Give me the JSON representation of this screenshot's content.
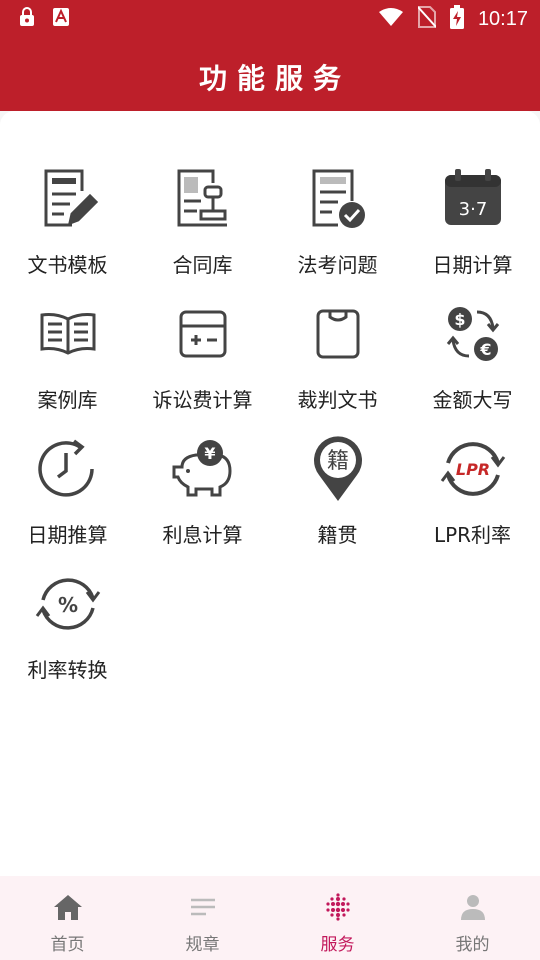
{
  "status_bar": {
    "time": "10:17"
  },
  "page_title": "功能服务",
  "services": [
    {
      "label": "文书模板",
      "icon": "document-edit-icon"
    },
    {
      "label": "合同库",
      "icon": "contract-stamp-icon"
    },
    {
      "label": "法考问题",
      "icon": "document-check-icon"
    },
    {
      "label": "日期计算",
      "icon": "calendar-icon",
      "icon_text": "3·7"
    },
    {
      "label": "案例库",
      "icon": "open-book-icon"
    },
    {
      "label": "诉讼费计算",
      "icon": "calculator-icon"
    },
    {
      "label": "裁判文书",
      "icon": "clipboard-icon"
    },
    {
      "label": "金额大写",
      "icon": "currency-exchange-icon",
      "icon_text_a": "$",
      "icon_text_b": "€"
    },
    {
      "label": "日期推算",
      "icon": "clock-forward-icon"
    },
    {
      "label": "利息计算",
      "icon": "piggy-bank-icon",
      "icon_text": "¥"
    },
    {
      "label": "籍贯",
      "icon": "location-pin-icon",
      "icon_text": "籍"
    },
    {
      "label": "LPR利率",
      "icon": "lpr-cycle-icon",
      "icon_text": "LPR"
    },
    {
      "label": "利率转换",
      "icon": "percent-cycle-icon",
      "icon_text": "%"
    }
  ],
  "tabs": [
    {
      "label": "首页",
      "icon": "home-icon",
      "active": false
    },
    {
      "label": "规章",
      "icon": "list-icon",
      "active": false
    },
    {
      "label": "服务",
      "icon": "dots-grid-icon",
      "active": true
    },
    {
      "label": "我的",
      "icon": "person-icon",
      "active": false
    }
  ],
  "colors": {
    "brand_red": "#bd1f2a",
    "active_tab": "#c2185b",
    "icon_gray": "#444444"
  }
}
